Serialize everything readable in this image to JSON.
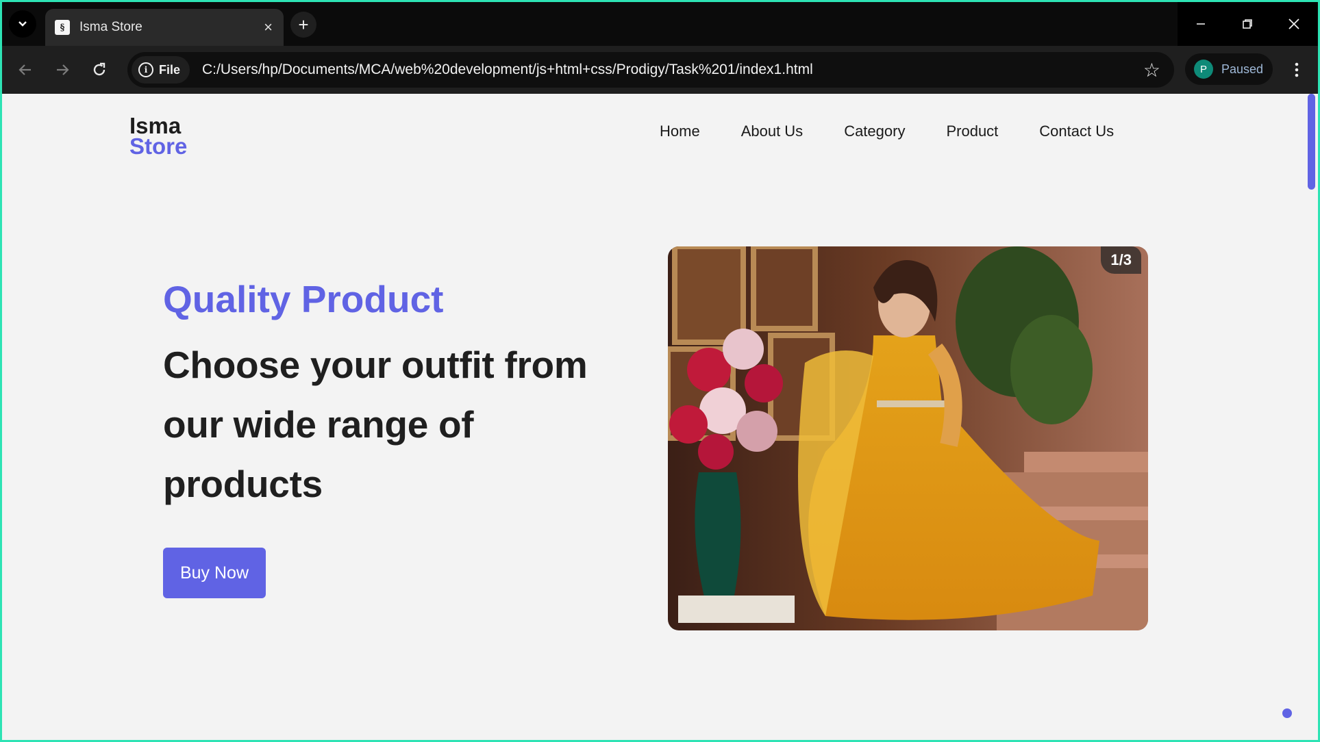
{
  "browser": {
    "tab_title": "Isma Store",
    "favicon": "page-icon",
    "close_glyph": "×",
    "new_tab_glyph": "+",
    "file_label": "File",
    "url": "C:/Users/hp/Documents/MCA/web%20development/js+html+css/Prodigy/Task%201/index1.html",
    "profile_initial": "P",
    "profile_status": "Paused"
  },
  "logo": {
    "line1": "Isma",
    "line2": "Store"
  },
  "nav": {
    "items": [
      "Home",
      "About Us",
      "Category",
      "Product",
      "Contact Us"
    ]
  },
  "hero": {
    "eyebrow": "Quality Product",
    "headline_line1": "Choose your outfit from",
    "headline_line2": "our wide range of",
    "headline_line3": "products",
    "cta": "Buy Now"
  },
  "slider": {
    "counter": "1/3"
  },
  "colors": {
    "accent": "#6063e4",
    "text": "#1f1f1f",
    "page_bg": "#f3f3f3",
    "frame": "#2de3b4"
  }
}
